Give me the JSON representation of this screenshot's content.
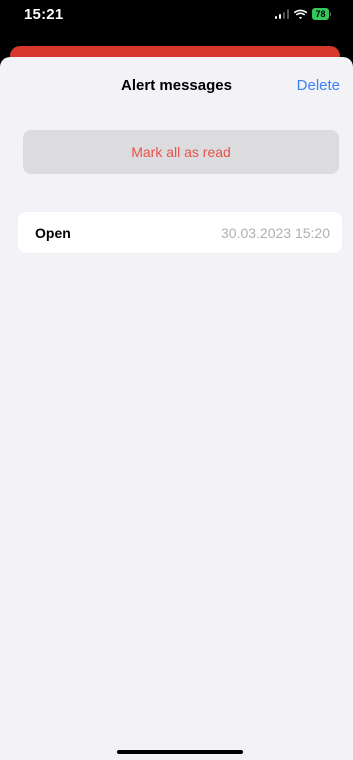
{
  "status_bar": {
    "time": "15:21",
    "battery": "78",
    "icons": [
      "signal-icon",
      "wifi-icon",
      "battery-icon"
    ]
  },
  "header": {
    "title": "Alert messages",
    "delete_label": "Delete"
  },
  "actions": {
    "mark_all_read_label": "Mark all as read"
  },
  "alerts": [
    {
      "status": "Open",
      "date": "30.03.2023 15:20"
    }
  ],
  "colors": {
    "accent_blue": "#3b82f6",
    "destructive_red": "#e8514a",
    "underlay_red": "#d6392c",
    "battery_green": "#34c759",
    "sheet_background": "#f2f2f7"
  }
}
